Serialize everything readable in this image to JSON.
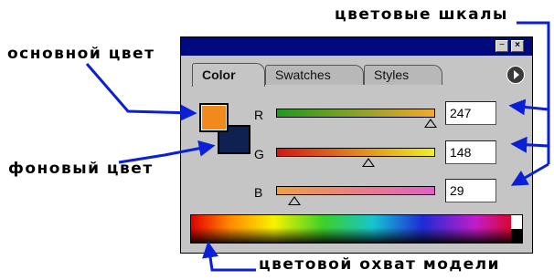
{
  "annotations": {
    "color_scales": "цветовые шкалы",
    "main_color": "основной цвет",
    "background_color": "фоновый цвет",
    "model_gamut": "цветовой охват модели"
  },
  "palette": {
    "tabs": [
      {
        "label": "Color",
        "active": true
      },
      {
        "label": "Swatches",
        "active": false
      },
      {
        "label": "Styles",
        "active": false
      }
    ],
    "window_buttons": {
      "minimize": "−",
      "close": "×"
    },
    "foreground_color": "#f08a1d",
    "background_color": "#0f2150",
    "channels": [
      {
        "label": "R",
        "value": "247",
        "gradient": [
          "#1f9a1f",
          "#f2a830"
        ]
      },
      {
        "label": "G",
        "value": "148",
        "gradient": [
          "#d01818",
          "#f0f020"
        ]
      },
      {
        "label": "B",
        "value": "29",
        "gradient": [
          "#f0a040",
          "#e060c8"
        ]
      }
    ]
  },
  "colors": {
    "titlebar": "#000a7e",
    "annotation_arrows": "#0a1fd6"
  }
}
